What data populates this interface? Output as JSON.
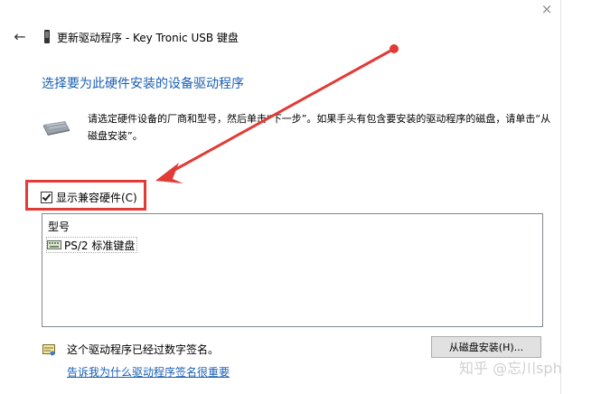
{
  "window": {
    "close_glyph": "×",
    "back_glyph": "←",
    "title": "更新驱动程序 - Key Tronic USB 键盘"
  },
  "main": {
    "heading": "选择要为此硬件安装的设备驱动程序",
    "instructions": "请选定硬件设备的厂商和型号，然后单击“下一步”。如果手头有包含要安装的驱动程序的磁盘，请单击“从磁盘安装”。",
    "show_compatible_label": "显示兼容硬件(C)",
    "show_compatible_checked": true,
    "list": {
      "header": "型号",
      "items": [
        "PS/2 标准键盘"
      ]
    },
    "signature_text": "这个驱动程序已经过数字签名。",
    "signature_link": "告诉我为什么驱动程序签名很重要",
    "have_disk_button": "从磁盘安装(H)..."
  },
  "annotation": {
    "highlight_color": "#e23b36",
    "arrow_color": "#e23b36"
  },
  "watermark": "知乎 @忘川sph"
}
